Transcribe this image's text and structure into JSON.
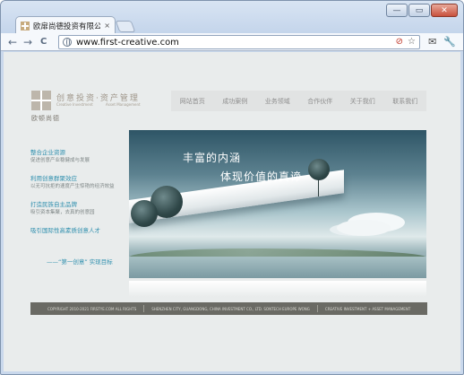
{
  "browser": {
    "tab_title": "欧扉尚德投资有限公司 - ...",
    "tab_close": "×",
    "url": "www.first-creative.com",
    "nav": {
      "back": "←",
      "forward": "→",
      "reload": "C"
    },
    "window_buttons": {
      "minimize": "—",
      "maximize": "▭",
      "close": "✕"
    },
    "omni_icons": {
      "block": "⊘",
      "star": "☆"
    },
    "tools": {
      "page": "✉",
      "wrench": "🔧"
    }
  },
  "site": {
    "logo": {
      "main": "创意投资·资产管理",
      "sub_left": "Creative Investment",
      "sub_right": "Asset Management",
      "cn_name": "欧顿尚德"
    },
    "nav": [
      {
        "label": "网站首页"
      },
      {
        "label": "成功案例"
      },
      {
        "label": "业务领域"
      },
      {
        "label": "合作伙伴"
      },
      {
        "label": "关于我们"
      },
      {
        "label": "联系我们"
      }
    ],
    "side": [
      {
        "title": "整合企业资源",
        "desc": "促进创意产业稳健成与发展"
      },
      {
        "title": "利用创意群聚效应",
        "desc": "以无可抗拒的速度产生惊艳的经济效益"
      },
      {
        "title": "打造民族自主品牌",
        "desc": "吸引资本集聚，去真的创意园"
      },
      {
        "title": "吸引国际性高素质创意人才",
        "desc": ""
      }
    ],
    "motto": "——“第一创意”  实现目标",
    "banner": {
      "headline1": "丰富的内涵",
      "headline2": "体现价值的真谛"
    },
    "footer": [
      "COPYRIGHT 2010-2021 FIRSTYE.COM   ALL RIGHTS",
      "SHENZHEN CITY, GUANGDONG, CHINA INVESTMENT CO., LTD. SONTECH EUROPE WONG",
      "CREATIVE INVESTMENT + ASSET MANAGEMENT"
    ]
  }
}
